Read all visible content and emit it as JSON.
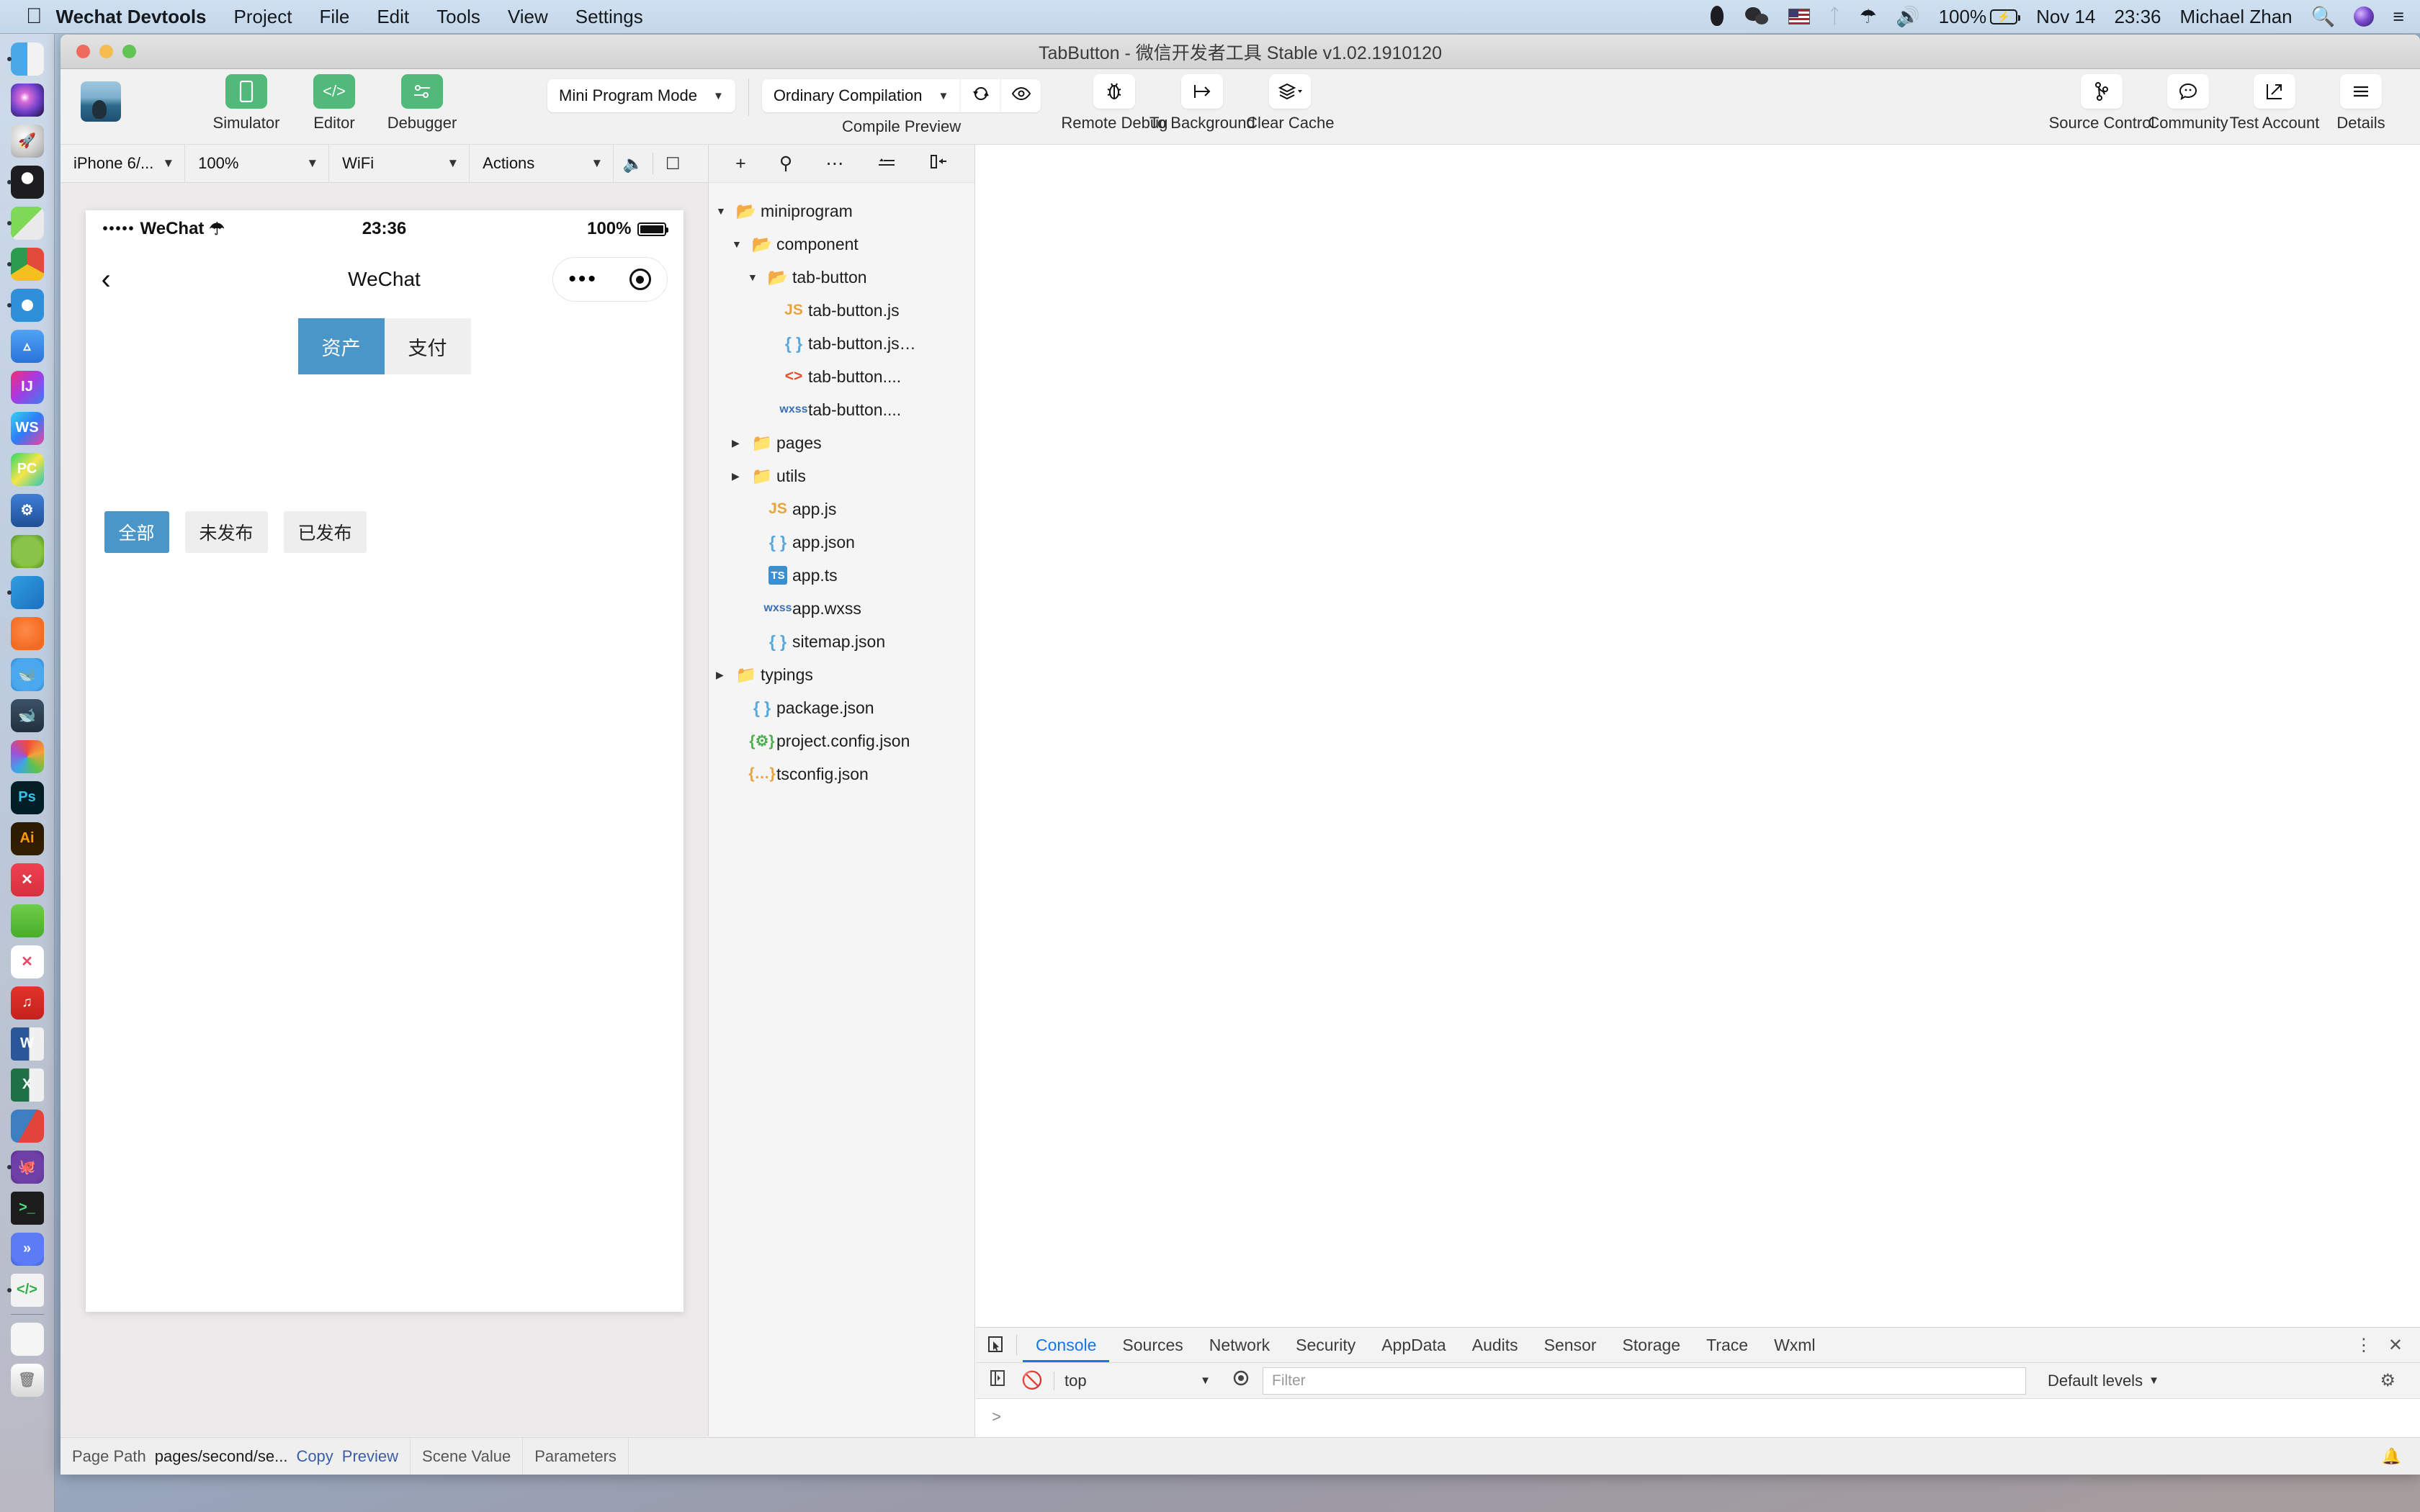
{
  "menubar": {
    "apple_icon": "apple-logo",
    "items": [
      {
        "label": "Wechat Devtools",
        "bold": true
      },
      {
        "label": "Project",
        "bold": false
      },
      {
        "label": "File",
        "bold": false
      },
      {
        "label": "Edit",
        "bold": false
      },
      {
        "label": "Tools",
        "bold": false
      },
      {
        "label": "View",
        "bold": false
      },
      {
        "label": "Settings",
        "bold": false
      }
    ],
    "status": {
      "battery_percent": "100%",
      "date": "Nov 14",
      "time": "23:36",
      "user": "Michael Zhan"
    }
  },
  "window": {
    "title": "TabButton - 微信开发者工具 Stable v1.02.1910120"
  },
  "toolbar": {
    "mode_buttons": [
      {
        "label": "Simulator",
        "icon": "phone-icon"
      },
      {
        "label": "Editor",
        "icon": "code-icon"
      },
      {
        "label": "Debugger",
        "icon": "sliders-icon"
      }
    ],
    "program_mode": "Mini Program Mode",
    "compilation_mode": "Ordinary Compilation",
    "compile_preview_label": "Compile Preview",
    "actions": [
      {
        "label": "Remote Debug",
        "icon": "bug-icon"
      },
      {
        "label": "To Background",
        "icon": "to-background-icon"
      },
      {
        "label": "Clear Cache",
        "icon": "layers-icon"
      }
    ],
    "right_actions": [
      {
        "label": "Source Control",
        "icon": "branch-icon"
      },
      {
        "label": "Community",
        "icon": "chat-icon"
      },
      {
        "label": "Test Account",
        "icon": "external-link-icon"
      },
      {
        "label": "Details",
        "icon": "hamburger-icon"
      }
    ]
  },
  "simulator_bar": {
    "device": "iPhone 6/...",
    "zoom": "100%",
    "network": "WiFi",
    "actions": "Actions"
  },
  "phone": {
    "status": {
      "carrier": "WeChat",
      "signal_dots": "•••••",
      "time": "23:36",
      "battery": "100%"
    },
    "nav_title": "WeChat",
    "tabs": [
      {
        "label": "资产",
        "active": true
      },
      {
        "label": "支付",
        "active": false
      }
    ],
    "chips": [
      {
        "label": "全部",
        "active": true
      },
      {
        "label": "未发布",
        "active": false
      },
      {
        "label": "已发布",
        "active": false
      }
    ]
  },
  "tree_tools": [
    "plus-icon",
    "search-icon",
    "more-icon",
    "sort-icon",
    "collapse-icon"
  ],
  "file_tree": [
    {
      "depth": 0,
      "label": "miniprogram",
      "type": "folder",
      "expanded": true
    },
    {
      "depth": 1,
      "label": "component",
      "type": "folder",
      "expanded": true
    },
    {
      "depth": 2,
      "label": "tab-button",
      "type": "folder",
      "expanded": true
    },
    {
      "depth": 3,
      "label": "tab-button.js",
      "type": "js"
    },
    {
      "depth": 3,
      "label": "tab-button.js…",
      "type": "json"
    },
    {
      "depth": 3,
      "label": "tab-button....",
      "type": "wxml"
    },
    {
      "depth": 3,
      "label": "tab-button....",
      "type": "wxss"
    },
    {
      "depth": 1,
      "label": "pages",
      "type": "folder",
      "expanded": false
    },
    {
      "depth": 1,
      "label": "utils",
      "type": "folder",
      "expanded": false
    },
    {
      "depth": 2,
      "label": "app.js",
      "type": "js"
    },
    {
      "depth": 2,
      "label": "app.json",
      "type": "json"
    },
    {
      "depth": 2,
      "label": "app.ts",
      "type": "ts"
    },
    {
      "depth": 2,
      "label": "app.wxss",
      "type": "wxss"
    },
    {
      "depth": 2,
      "label": "sitemap.json",
      "type": "json"
    },
    {
      "depth": 0,
      "label": "typings",
      "type": "folder",
      "expanded": false
    },
    {
      "depth": 1,
      "label": "package.json",
      "type": "json"
    },
    {
      "depth": 1,
      "label": "project.config.json",
      "type": "cfg"
    },
    {
      "depth": 1,
      "label": "tsconfig.json",
      "type": "tscfg"
    }
  ],
  "devtools": {
    "tabs": [
      {
        "label": "Console",
        "selected": true
      },
      {
        "label": "Sources",
        "selected": false
      },
      {
        "label": "Network",
        "selected": false
      },
      {
        "label": "Security",
        "selected": false
      },
      {
        "label": "AppData",
        "selected": false
      },
      {
        "label": "Audits",
        "selected": false
      },
      {
        "label": "Sensor",
        "selected": false
      },
      {
        "label": "Storage",
        "selected": false
      },
      {
        "label": "Trace",
        "selected": false
      },
      {
        "label": "Wxml",
        "selected": false
      }
    ],
    "context": "top",
    "filter_placeholder": "Filter",
    "levels": "Default levels",
    "prompt": ">"
  },
  "statusbar": {
    "page_path_label": "Page Path",
    "page_path_value": "pages/second/se...",
    "copy_label": "Copy",
    "preview_label": "Preview",
    "scene_value_label": "Scene Value",
    "parameters_label": "Parameters"
  },
  "dock": [
    {
      "name": "finder",
      "running": true
    },
    {
      "name": "siri",
      "running": false
    },
    {
      "name": "launchpad",
      "running": false
    },
    {
      "name": "qq",
      "running": true
    },
    {
      "name": "wechat",
      "running": true
    },
    {
      "name": "chrome",
      "running": true
    },
    {
      "name": "safari",
      "running": true
    },
    {
      "name": "app-store",
      "running": false
    },
    {
      "name": "intellij-idea",
      "running": false
    },
    {
      "name": "webstorm",
      "running": false
    },
    {
      "name": "pycharm",
      "running": false
    },
    {
      "name": "xcode",
      "running": false
    },
    {
      "name": "android-studio",
      "running": false
    },
    {
      "name": "vscode",
      "running": true
    },
    {
      "name": "postman",
      "running": false
    },
    {
      "name": "docker",
      "running": false
    },
    {
      "name": "mysql-workbench",
      "running": false
    },
    {
      "name": "navicat",
      "running": false
    },
    {
      "name": "photoshop",
      "running": false
    },
    {
      "name": "illustrator",
      "running": false
    },
    {
      "name": "xmind",
      "running": false
    },
    {
      "name": "graph-app",
      "running": false
    },
    {
      "name": "xmind-zen",
      "running": false
    },
    {
      "name": "netease-music",
      "running": false
    },
    {
      "name": "word",
      "running": false
    },
    {
      "name": "excel",
      "running": false
    },
    {
      "name": "teamviewer",
      "running": false
    },
    {
      "name": "github-desktop",
      "running": true
    },
    {
      "name": "terminal",
      "running": false
    },
    {
      "name": "remote-desktop",
      "running": false
    },
    {
      "name": "wechat-devtools",
      "running": true
    },
    {
      "name": "zip-file",
      "running": false
    },
    {
      "name": "trash",
      "running": false
    }
  ]
}
